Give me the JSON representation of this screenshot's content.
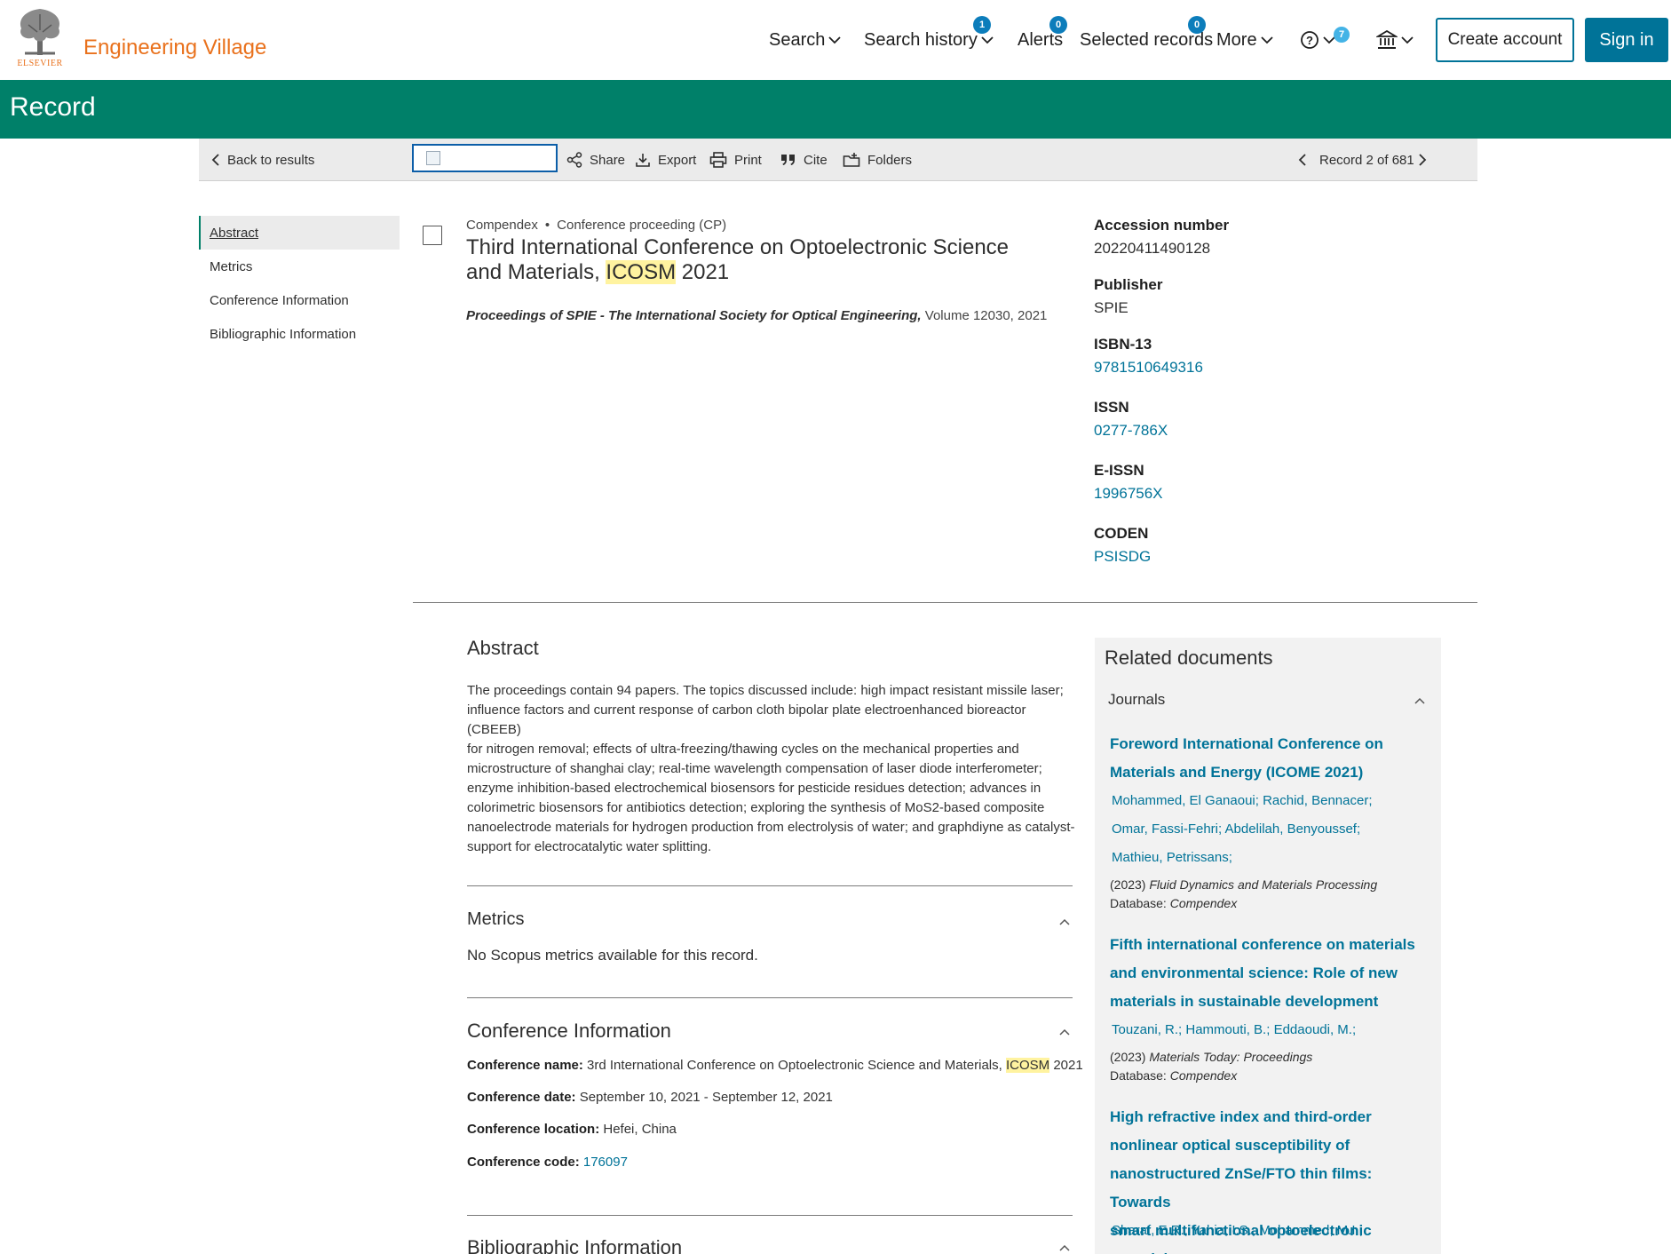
{
  "header": {
    "brand": "Engineering Village",
    "logo_word": "ELSEVIER",
    "nav": {
      "search": "Search",
      "search_history": "Search history",
      "search_history_badge": "1",
      "alerts": "Alerts",
      "alerts_badge": "0",
      "selected_records": "Selected records",
      "selected_records_badge": "0",
      "more": "More",
      "help_badge": "7"
    },
    "create_account": "Create account",
    "sign_in": "Sign in"
  },
  "page_title": "Record",
  "toolbar": {
    "back": "Back to results",
    "share": "Share",
    "export": "Export",
    "print": "Print",
    "cite": "Cite",
    "folders": "Folders",
    "record_position": "Record 2 of 681"
  },
  "left_nav": {
    "abstract": "Abstract",
    "metrics": "Metrics",
    "conference_info": "Conference Information",
    "bibliographic_info": "Bibliographic Information"
  },
  "record": {
    "database": "Compendex",
    "doc_type": "Conference proceeding (CP)",
    "title_before": "Third International Conference on Optoelectronic Science and Materials, ",
    "title_highlight": "ICOSM",
    "title_after": " 2021",
    "source_journal": "Proceedings of SPIE - The International Society for Optical Engineering,",
    "source_details": " Volume 12030, 2021"
  },
  "facts": [
    {
      "label": "Accession number",
      "value": "20220411490128",
      "link": false
    },
    {
      "label": "Publisher",
      "value": "SPIE",
      "link": false
    },
    {
      "label": "ISBN-13",
      "value": "9781510649316",
      "link": true
    },
    {
      "label": "ISSN",
      "value": "0277-786X",
      "link": true
    },
    {
      "label": "E-ISSN",
      "value": "1996756X",
      "link": true
    },
    {
      "label": "CODEN",
      "value": "PSISDG",
      "link": true
    }
  ],
  "abstract": {
    "heading": "Abstract",
    "lines": [
      "The proceedings contain 94 papers. The topics discussed include: high impact resistant missile laser;",
      "influence factors and current response of carbon cloth bipolar plate electroenhanced bioreactor (CBEEB)",
      "for nitrogen removal; effects of ultra-freezing/thawing cycles on the mechanical properties and",
      "microstructure of shanghai clay; real-time wavelength compensation of laser diode interferometer;",
      "enzyme inhibition-based electrochemical biosensors for pesticide residues detection; advances in",
      "colorimetric biosensors for antibiotics detection; exploring the synthesis of MoS2-based composite",
      "nanoelectrode materials for hydrogen production from electrolysis of water; and graphdiyne as catalyst-",
      "support for electrocatalytic water splitting."
    ]
  },
  "metrics": {
    "heading": "Metrics",
    "text": "No Scopus metrics available for this record."
  },
  "conference": {
    "heading": "Conference Information",
    "name_label": "Conference name:",
    "name_before": " 3rd International Conference on Optoelectronic Science and Materials, ",
    "name_highlight": "ICOSM",
    "name_after": " 2021",
    "date_label": "Conference date:",
    "date_value": " September 10, 2021 - September 12, 2021",
    "location_label": "Conference location:",
    "location_value": " Hefei, China",
    "code_label": "Conference code:",
    "code_value": "176097"
  },
  "bibliographic": {
    "heading": "Bibliographic Information"
  },
  "related": {
    "heading": "Related documents",
    "subheading": "Journals",
    "doc1": {
      "title_lines": [
        "Foreword International Conference on",
        "Materials and Energy (ICOME 2021)"
      ],
      "author_lines": [
        "Mohammed, El Ganaoui; Rachid, Bennacer;",
        "Omar, Fassi-Fehri; Abdelilah, Benyoussef;",
        "Mathieu, Petrissans;"
      ],
      "year": "(2023)",
      "journal": "Fluid Dynamics and Materials Processing",
      "db_label": "Database:",
      "db": "Compendex"
    },
    "doc2": {
      "title_lines": [
        "Fifth international conference on materials",
        "and environmental science: Role of new",
        "materials in sustainable development"
      ],
      "author_lines": [
        "Touzani, R.; Hammouti, B.; Eddaoudi, M.;"
      ],
      "year": "(2023)",
      "journal": "Materials Today: Proceedings",
      "db_label": "Database:",
      "db": "Compendex"
    },
    "doc3": {
      "title_lines": [
        "High refractive index and third-order",
        "nonlinear optical susceptibility of",
        "nanostructured ZnSe/FTO thin films: Towards",
        "smart multifunctional optoelectronic materials"
      ],
      "author_lines": [
        "Sharaf, E.R.; Yahia, I.S.; Mohammed, M.I.;"
      ]
    }
  }
}
